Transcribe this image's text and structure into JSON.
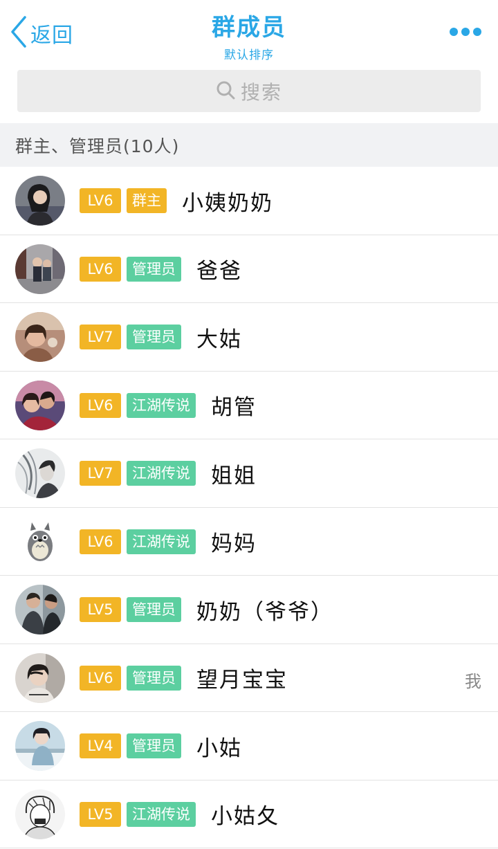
{
  "nav": {
    "back_label": "返回",
    "title": "群成员",
    "subtitle": "默认排序"
  },
  "search": {
    "placeholder": "搜索"
  },
  "section": {
    "title": "群主、管理员(10人)"
  },
  "colors": {
    "accent": "#2aa7e6",
    "level_badge": "#f2b526",
    "owner_badge": "#f2b526",
    "admin_badge": "#5ccfa0"
  },
  "members": [
    {
      "level": "LV6",
      "role": "群主",
      "role_type": "owner",
      "name": "小姨奶奶",
      "me": ""
    },
    {
      "level": "LV6",
      "role": "管理员",
      "role_type": "admin",
      "name": "爸爸",
      "me": ""
    },
    {
      "level": "LV7",
      "role": "管理员",
      "role_type": "admin",
      "name": "大姑",
      "me": ""
    },
    {
      "level": "LV6",
      "role": "江湖传说",
      "role_type": "title",
      "name": "胡管",
      "me": ""
    },
    {
      "level": "LV7",
      "role": "江湖传说",
      "role_type": "title",
      "name": "姐姐",
      "me": ""
    },
    {
      "level": "LV6",
      "role": "江湖传说",
      "role_type": "title",
      "name": "妈妈",
      "me": ""
    },
    {
      "level": "LV5",
      "role": "管理员",
      "role_type": "admin",
      "name": "奶奶（爷爷）",
      "me": ""
    },
    {
      "level": "LV6",
      "role": "管理员",
      "role_type": "admin",
      "name": "望月宝宝",
      "me": "我"
    },
    {
      "level": "LV4",
      "role": "管理员",
      "role_type": "admin",
      "name": "小姑",
      "me": ""
    },
    {
      "level": "LV5",
      "role": "江湖传说",
      "role_type": "title",
      "name": "小姑夂",
      "me": ""
    }
  ]
}
